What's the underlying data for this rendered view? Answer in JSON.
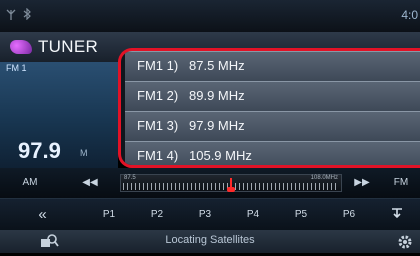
{
  "status_bar": {
    "clock": "4:0"
  },
  "header": {
    "title": "TUNER"
  },
  "current": {
    "band": "FM 1",
    "frequency": "97.9",
    "unit": "M"
  },
  "presets": [
    {
      "name": "FM1 1)",
      "freq": "87.5 MHz"
    },
    {
      "name": "FM1 2)",
      "freq": "89.9 MHz"
    },
    {
      "name": "FM1 3)",
      "freq": "97.9 MHz"
    },
    {
      "name": "FM1 4)",
      "freq": "105.9 MHz"
    }
  ],
  "controls": {
    "am": "AM",
    "seek_back": "◀◀",
    "seek_forward": "▶▶",
    "fm": "FM",
    "scale_min": "87.5",
    "scale_max": "108.0MHz",
    "tuning_position": 0.5
  },
  "preset_buttons": {
    "prev": "«",
    "p1": "P1",
    "p2": "P2",
    "p3": "P3",
    "p4": "P4",
    "p5": "P5",
    "p6": "P6"
  },
  "bottom_bar": {
    "status": "Locating Satellites"
  },
  "colors": {
    "highlight": "#e21226",
    "needle": "#ff2a2a"
  },
  "icons": [
    "antenna-icon",
    "bluetooth-icon",
    "tuner-logo-icon",
    "search-icon",
    "settings-icon",
    "memory-icon"
  ]
}
